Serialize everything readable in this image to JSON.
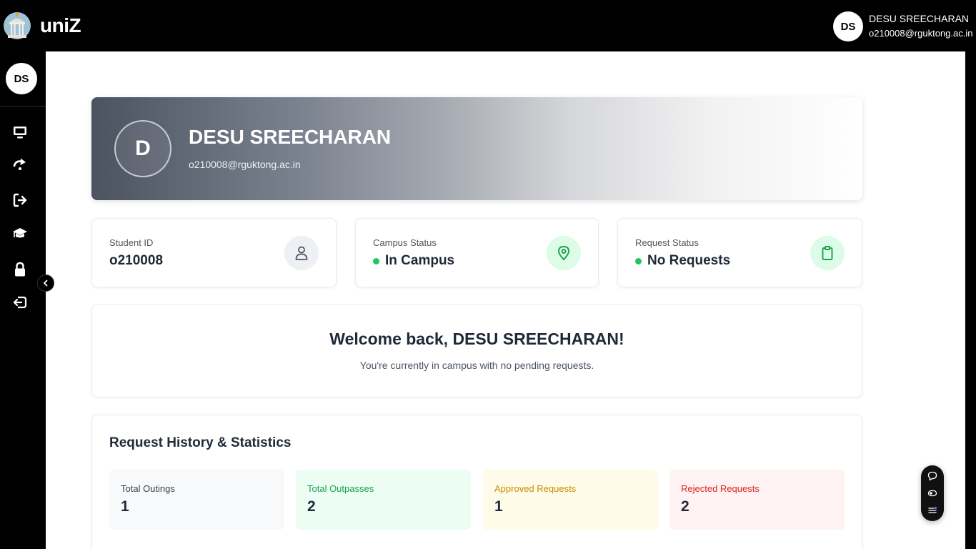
{
  "app": {
    "brand": "uniZ"
  },
  "user": {
    "initials": "DS",
    "name": "DESU SREECHARAN",
    "email": "o210008@rguktong.ac.in"
  },
  "sidebar": {
    "avatar_initials": "DS",
    "items": [
      {
        "icon": "monitor-icon"
      },
      {
        "icon": "redo-arrow-icon"
      },
      {
        "icon": "sign-out-box-icon"
      },
      {
        "icon": "graduation-cap-icon"
      },
      {
        "icon": "lock-icon"
      },
      {
        "icon": "logout-icon"
      }
    ]
  },
  "hero": {
    "avatar_letter": "D",
    "name": "DESU SREECHARAN",
    "email": "o210008@rguktong.ac.in"
  },
  "stats": [
    {
      "label": "Student ID",
      "value": "o210008",
      "icon": "user-icon"
    },
    {
      "label": "Campus Status",
      "value": "In Campus",
      "icon": "map-pin-icon",
      "status_color": "#22c55e"
    },
    {
      "label": "Request Status",
      "value": "No Requests",
      "icon": "clipboard-icon",
      "status_color": "#22c55e"
    }
  ],
  "welcome": {
    "title": "Welcome back, DESU SREECHARAN!",
    "subtitle": "You're currently in campus with no pending requests."
  },
  "history": {
    "title": "Request History & Statistics",
    "cards": [
      {
        "label": "Total Outings",
        "value": "1"
      },
      {
        "label": "Total Outpasses",
        "value": "2"
      },
      {
        "label": "Approved Requests",
        "value": "1"
      },
      {
        "label": "Rejected Requests",
        "value": "2"
      }
    ]
  },
  "colors": {
    "total_outings_bg": "#f8f9fb",
    "total_outpasses_bg": "#ecfdf3",
    "approved_bg": "#fefce8",
    "rejected_bg": "#fef2f2",
    "green": "#16a34a",
    "amber": "#ca8a04",
    "red": "#dc2626"
  }
}
